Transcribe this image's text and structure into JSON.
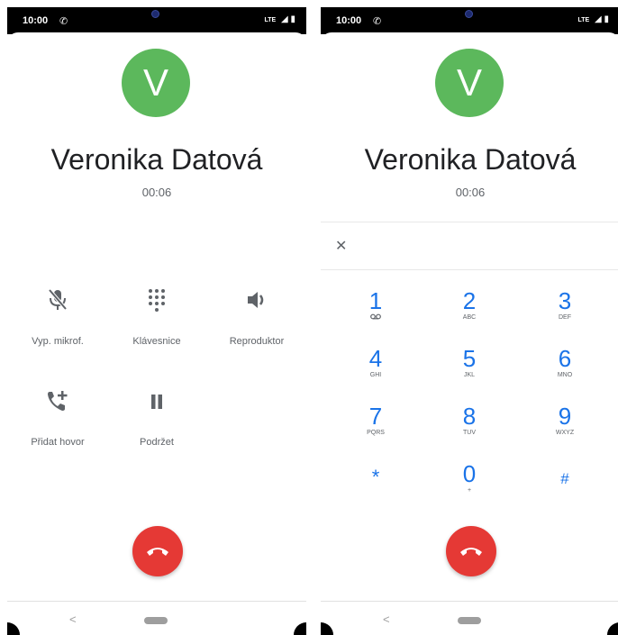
{
  "status_bar": {
    "time": "10:00",
    "network": "LTE"
  },
  "contact": {
    "initial": "V",
    "name": "Veronika Datová",
    "timer": "00:06"
  },
  "call_actions": {
    "mute": "Vyp. mikrof.",
    "keypad": "Klávesnice",
    "speaker": "Reproduktor",
    "add_call": "Přidat hovor",
    "hold": "Podržet"
  },
  "dialpad": {
    "keys": [
      {
        "digit": "1",
        "letters": ""
      },
      {
        "digit": "2",
        "letters": "ABC"
      },
      {
        "digit": "3",
        "letters": "DEF"
      },
      {
        "digit": "4",
        "letters": "GHI"
      },
      {
        "digit": "5",
        "letters": "JKL"
      },
      {
        "digit": "6",
        "letters": "MNO"
      },
      {
        "digit": "7",
        "letters": "PQRS"
      },
      {
        "digit": "8",
        "letters": "TUV"
      },
      {
        "digit": "9",
        "letters": "WXYZ"
      },
      {
        "digit": "*",
        "letters": ""
      },
      {
        "digit": "0",
        "letters": "+"
      },
      {
        "digit": "#",
        "letters": ""
      }
    ]
  },
  "nav": {
    "back": "<"
  },
  "colors": {
    "avatar": "#5cb85c",
    "hangup": "#e53935",
    "dial_digit": "#1a73e8",
    "icon": "#5f6368"
  },
  "icons": {
    "mute": "mic-off-icon",
    "keypad": "dialpad-icon",
    "speaker": "volume-icon",
    "add_call": "add-call-icon",
    "hold": "pause-icon",
    "hangup": "call-end-icon",
    "voicemail": "voicemail-icon",
    "close": "close-icon"
  }
}
